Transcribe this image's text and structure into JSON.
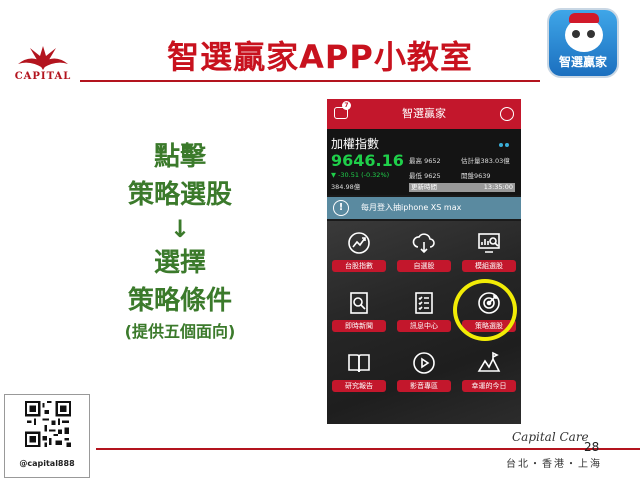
{
  "slide": {
    "title": "智選贏家APP小教室",
    "logo_text": "CAPITAL",
    "app_icon_label": "智選贏家",
    "instructions": [
      "點擊",
      "策略選股",
      "↓",
      "選擇",
      "策略條件",
      "(提供五個面向)"
    ],
    "qr_handle": "@capital888",
    "page_number": "28",
    "brand": "Capital Care",
    "cities": "台北・香港・上海",
    "colors": {
      "brand_red": "#c8121e",
      "instruction_green": "#3b7a2b",
      "highlight": "#f2ec06"
    }
  },
  "app": {
    "title": "智選贏家",
    "message_badge": "7",
    "quote": {
      "name": "加權指數",
      "price": "9646.16",
      "change": "▼ -30.51 (-0.32%)",
      "volume": "384.98億",
      "high": "最高 9652",
      "estimate": "估計量383.03億",
      "low": "最低 9625",
      "open": "開盤9639",
      "update_label": "更新時間",
      "update_time": "13:35:00"
    },
    "banner": "每月登入抽iphone XS max",
    "menu": [
      {
        "label": "台股指數",
        "icon": "chart-icon"
      },
      {
        "label": "自選股",
        "icon": "cloud-download-icon"
      },
      {
        "label": "模組選股",
        "icon": "monitor-search-icon"
      },
      {
        "label": "即時新聞",
        "icon": "news-icon"
      },
      {
        "label": "訊息中心",
        "icon": "checklist-icon"
      },
      {
        "label": "策略選股",
        "icon": "target-icon"
      },
      {
        "label": "研究報告",
        "icon": "book-icon"
      },
      {
        "label": "影音專區",
        "icon": "play-icon"
      },
      {
        "label": "幸運的今日",
        "icon": "map-icon"
      }
    ]
  }
}
